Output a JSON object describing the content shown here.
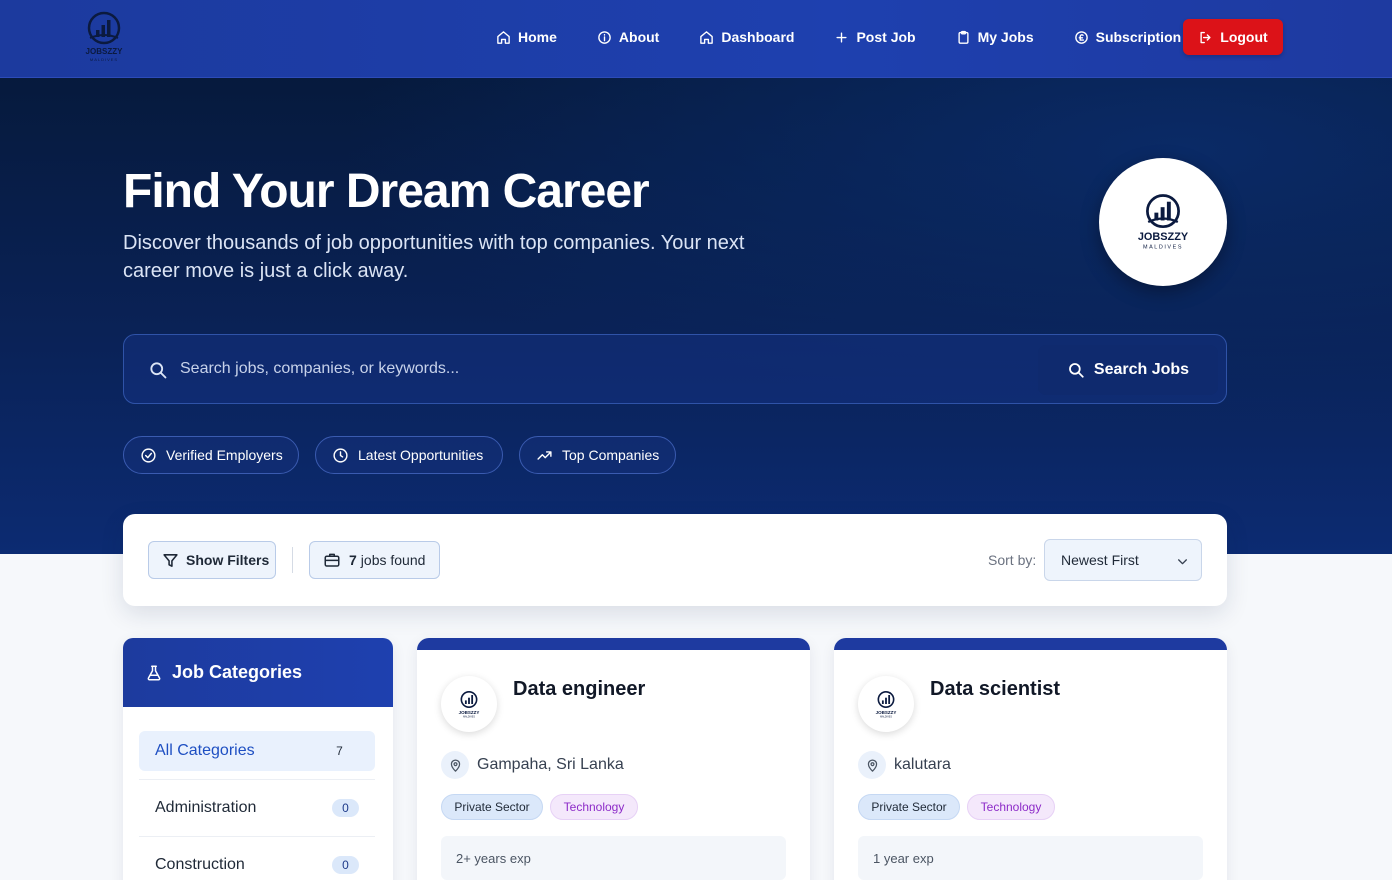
{
  "nav": {
    "brand": "JOBSZZY MALDIVES",
    "items": [
      {
        "label": "Home",
        "icon": "home-icon"
      },
      {
        "label": "About",
        "icon": "info-icon"
      },
      {
        "label": "Dashboard",
        "icon": "home-icon"
      },
      {
        "label": "Post Job",
        "icon": "plus-icon"
      },
      {
        "label": "My Jobs",
        "icon": "clipboard-icon"
      },
      {
        "label": "Subscription",
        "icon": "currency-icon"
      }
    ],
    "logout_label": "Logout"
  },
  "hero": {
    "title": "Find Your Dream Career",
    "subtitle": "Discover thousands of job opportunities with top companies. Your next career move is just a click away.",
    "badge_name": "JOBSZZY",
    "badge_sub": "MALDIVES"
  },
  "search": {
    "placeholder": "Search jobs, companies, or keywords...",
    "button_label": "Search Jobs"
  },
  "pills": [
    {
      "label": "Verified Employers",
      "icon": "check-circle-icon"
    },
    {
      "label": "Latest Opportunities",
      "icon": "clock-icon"
    },
    {
      "label": "Top Companies",
      "icon": "trending-up-icon"
    }
  ],
  "filters": {
    "show_filters_label": "Show Filters",
    "jobs_count": "7",
    "jobs_found_label": "jobs found",
    "sort_label": "Sort by:",
    "sort_value": "Newest First"
  },
  "sidebar": {
    "title": "Job Categories",
    "categories": [
      {
        "label": "All Categories",
        "count": "7"
      },
      {
        "label": "Administration",
        "count": "0"
      },
      {
        "label": "Construction",
        "count": "0"
      }
    ]
  },
  "jobs": [
    {
      "title": "Data engineer",
      "location": "Gampaha, Sri Lanka",
      "sector": "Private Sector",
      "category": "Technology",
      "experience": "2+ years exp"
    },
    {
      "title": "Data scientist",
      "location": "kalutara",
      "sector": "Private Sector",
      "category": "Technology",
      "experience": "1 year exp"
    }
  ],
  "colors": {
    "navbar": "#1e40af",
    "hero_dark": "#061a3d",
    "logout": "#dc1218",
    "accent": "#1e4fc2",
    "tech_tag": "#8d2bc8"
  }
}
